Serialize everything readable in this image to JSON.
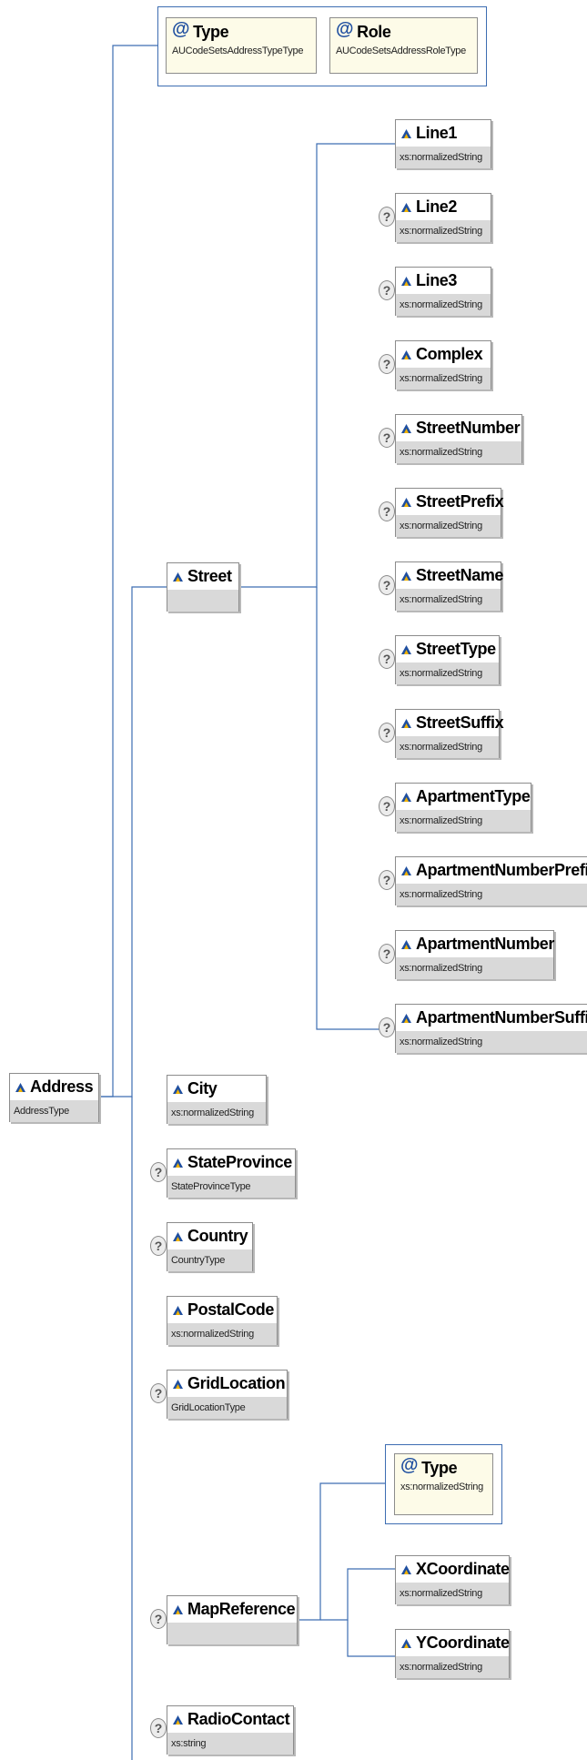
{
  "diagram": {
    "root": {
      "name": "Address",
      "type": "AddressType"
    },
    "root_attributes": [
      {
        "name": "Type",
        "type": "AUCodeSetsAddressTypeType"
      },
      {
        "name": "Role",
        "type": "AUCodeSetsAddressRoleType"
      }
    ],
    "street": {
      "name": "Street",
      "type": "",
      "children": [
        {
          "name": "Line1",
          "type": "xs:normalizedString",
          "optional": false
        },
        {
          "name": "Line2",
          "type": "xs:normalizedString",
          "optional": true
        },
        {
          "name": "Line3",
          "type": "xs:normalizedString",
          "optional": true
        },
        {
          "name": "Complex",
          "type": "xs:normalizedString",
          "optional": true
        },
        {
          "name": "StreetNumber",
          "type": "xs:normalizedString",
          "optional": true
        },
        {
          "name": "StreetPrefix",
          "type": "xs:normalizedString",
          "optional": true
        },
        {
          "name": "StreetName",
          "type": "xs:normalizedString",
          "optional": true
        },
        {
          "name": "StreetType",
          "type": "xs:normalizedString",
          "optional": true
        },
        {
          "name": "StreetSuffix",
          "type": "xs:normalizedString",
          "optional": true
        },
        {
          "name": "ApartmentType",
          "type": "xs:normalizedString",
          "optional": true
        },
        {
          "name": "ApartmentNumberPrefix",
          "type": "xs:normalizedString",
          "optional": true
        },
        {
          "name": "ApartmentNumber",
          "type": "xs:normalizedString",
          "optional": true
        },
        {
          "name": "ApartmentNumberSuffix",
          "type": "xs:normalizedString",
          "optional": true
        }
      ]
    },
    "elements": [
      {
        "name": "City",
        "type": "xs:normalizedString",
        "optional": false
      },
      {
        "name": "StateProvince",
        "type": "StateProvinceType",
        "optional": true
      },
      {
        "name": "Country",
        "type": "CountryType",
        "optional": true
      },
      {
        "name": "PostalCode",
        "type": "xs:normalizedString",
        "optional": false
      },
      {
        "name": "GridLocation",
        "type": "GridLocationType",
        "optional": true
      }
    ],
    "map_reference": {
      "name": "MapReference",
      "type": "",
      "optional": true,
      "attribute": {
        "name": "Type",
        "type": "xs:normalizedString"
      },
      "children": [
        {
          "name": "XCoordinate",
          "type": "xs:normalizedString",
          "optional": false
        },
        {
          "name": "YCoordinate",
          "type": "xs:normalizedString",
          "optional": false
        }
      ]
    },
    "radio_contact": {
      "name": "RadioContact",
      "type": "xs:string",
      "optional": true
    },
    "optional_marker": "?",
    "attribute_marker": "@"
  }
}
